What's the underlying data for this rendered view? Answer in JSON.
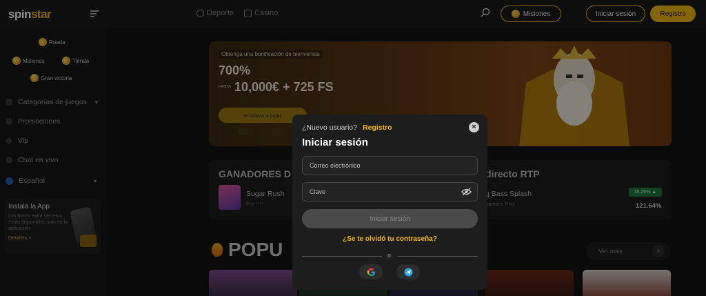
{
  "header": {
    "logo_main": "spin",
    "logo_accent": "star",
    "nav": [
      {
        "label": "Deporte",
        "icon": "soccer-ball-icon"
      },
      {
        "label": "Casino",
        "icon": "casino-icon"
      }
    ],
    "misiones_label": "Misiones",
    "login_label": "Iniciar sesión",
    "register_label": "Registro"
  },
  "sidebar": {
    "top_items": [
      {
        "label": "Rueda",
        "icon": "wheel-coin-icon"
      },
      {
        "label": "Misiones",
        "icon": "missions-coin-icon"
      },
      {
        "label": "Tienda",
        "icon": "shop-coin-icon"
      },
      {
        "label": "Gran victoria",
        "icon": "trophy-coin-icon"
      }
    ],
    "items": [
      {
        "label": "Categorías de juegos",
        "icon": "categories-icon"
      },
      {
        "label": "Promociones",
        "icon": "promotions-icon"
      },
      {
        "label": "Vip",
        "icon": "diamond-icon"
      },
      {
        "label": "Chat en vivo",
        "icon": "chat-icon"
      },
      {
        "label": "Español",
        "icon": "globe-icon"
      }
    ],
    "app": {
      "title": "Instala la App",
      "description": "Los bonos extra secretos están disponibles solo en la aplicación",
      "more": "Detalles >"
    }
  },
  "banner": {
    "chip": "Obtenga una bonificación de bienvenida",
    "percent": "700%",
    "hasta": "HASTA",
    "amount": "10,000€ + 725 FS",
    "cta": "Empieza a jugar"
  },
  "winners": {
    "title": "GANADORES D",
    "game": "Sugar Rush",
    "player": "Pla*****"
  },
  "rtp": {
    "title": "directo RTP",
    "game": "g Bass Splash",
    "provider": "agmatic Play",
    "badge": "35.25% ▲",
    "value": "121.64%"
  },
  "popular": {
    "title": "POPU",
    "ver_mas": "Ver más",
    "next_arrow": "›"
  },
  "modal": {
    "new_user": "¿Nuevo usuario?",
    "register_link": "Registro",
    "close": "×",
    "title": "Iniciar sesión",
    "email_placeholder": "Correo electrónico",
    "password_placeholder": "Clave",
    "submit": "Iniciar sesión",
    "forgot": "¿Se te olvidó tu contraseña?",
    "separator": "o",
    "social": [
      {
        "name": "google",
        "icon": "google-icon"
      },
      {
        "name": "telegram",
        "icon": "telegram-icon"
      }
    ]
  },
  "colors": {
    "accent": "#f5b80c",
    "background": "#131313",
    "modal": "#1d1d1d",
    "rtp_badge": "#1e7c3d"
  }
}
